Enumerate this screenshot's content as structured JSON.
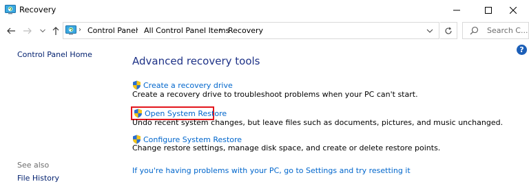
{
  "window": {
    "title": "Recovery"
  },
  "address_bar": {
    "breadcrumbs": [
      "Control Panel",
      "All Control Panel Items",
      "Recovery"
    ],
    "search_placeholder": "Search C..."
  },
  "left_pane": {
    "home_link": "Control Panel Home",
    "see_also_label": "See also",
    "see_also_links": [
      "File History"
    ]
  },
  "main": {
    "heading": "Advanced recovery tools",
    "tools": [
      {
        "label": "Create a recovery drive",
        "description": "Create a recovery drive to troubleshoot problems when your PC can't start."
      },
      {
        "label": "Open System Restore",
        "description": "Undo recent system changes, but leave files such as documents, pictures, and music unchanged.",
        "highlighted": true
      },
      {
        "label": "Configure System Restore",
        "description": "Change restore settings, manage disk space, and create or delete restore points."
      }
    ],
    "reset_link": "If you're having problems with your PC, go to Settings and try resetting it"
  },
  "colors": {
    "link": "#0066cc",
    "heading": "#1e3287",
    "highlight_border": "#e3141b",
    "help_icon": "#1c5fb8"
  }
}
